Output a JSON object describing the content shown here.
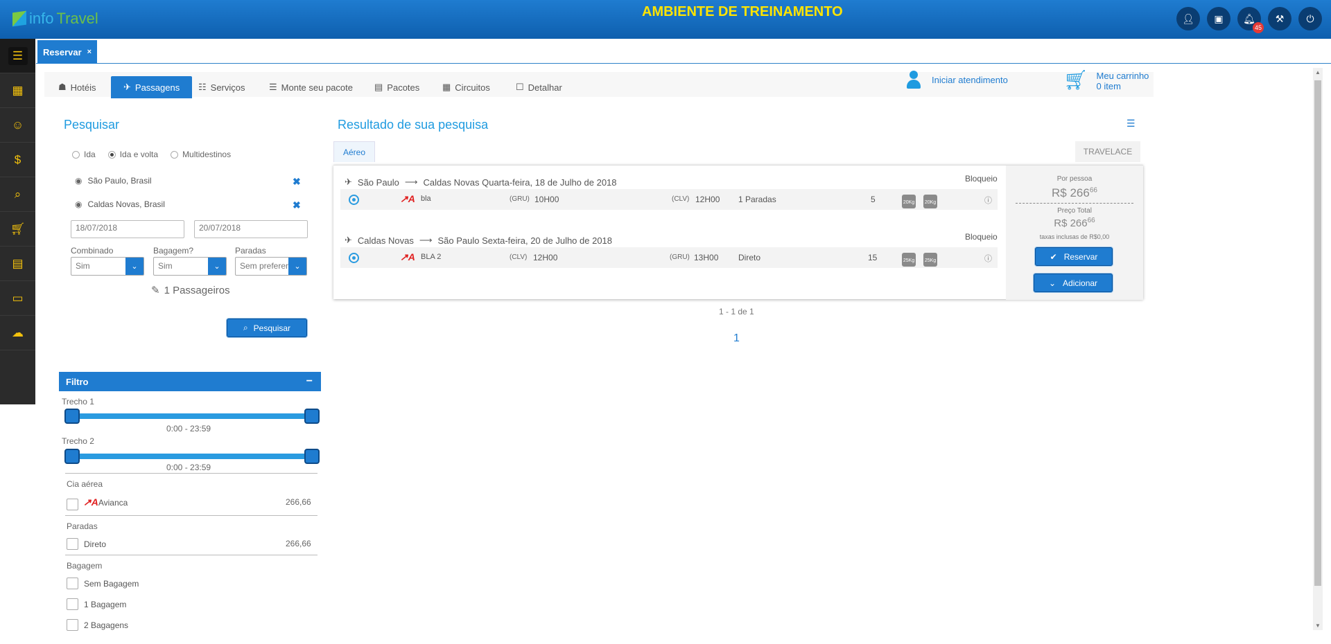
{
  "header": {
    "logo_info": "info",
    "logo_travel": "Travel",
    "env_title": "AMBIENTE DE TREINAMENTO",
    "notification_count": "45",
    "icons": [
      "user-icon",
      "money-icon",
      "bell-icon",
      "wrench-icon",
      "power-icon"
    ]
  },
  "leftnav": {
    "icons": [
      "list-icon",
      "building-icon",
      "users-icon",
      "dollar-icon",
      "search-icon",
      "cart-icon",
      "document-icon",
      "cash-icon",
      "cloud-icon"
    ]
  },
  "tabstrip": {
    "tab_label": "Reservar",
    "close": "×"
  },
  "main_tabs": {
    "hoteis": "Hotéis",
    "passagens": "Passagens",
    "servicos": "Serviços",
    "monte": "Monte seu pacote",
    "pacotes": "Pacotes",
    "circuitos": "Circuitos",
    "detalhar": "Detalhar",
    "iniciar": "Iniciar atendimento",
    "carrinho_title": "Meu carrinho",
    "carrinho_count": "0 item"
  },
  "search": {
    "title": "Pesquisar",
    "trip_types": [
      "Ida",
      "Ida e volta",
      "Multidestinos"
    ],
    "selected_trip_type": "Ida e volta",
    "origin": "São Paulo, Brasil",
    "destination": "Caldas Novas, Brasil",
    "date_out": "18/07/2018",
    "date_back": "20/07/2018",
    "combinado_label": "Combinado",
    "combinado_value": "Sim",
    "bagagem_label": "Bagagem?",
    "bagagem_value": "Sim",
    "paradas_label": "Paradas",
    "paradas_value": "Sem preferencia",
    "passengers": "1 Passageiros",
    "button": "Pesquisar"
  },
  "filter": {
    "title": "Filtro",
    "trecho1_label": "Trecho 1",
    "trecho1_range": "0:00 - 23:59",
    "trecho2_label": "Trecho 2",
    "trecho2_range": "0:00 - 23:59",
    "cia_label": "Cia aérea",
    "cia_item": "Avianca",
    "cia_price": "266,66",
    "paradas_label": "Paradas",
    "paradas_item": "Direto",
    "paradas_price": "266,66",
    "bagagem_label": "Bagagem",
    "bagagem_items": [
      "Sem Bagagem",
      "1 Bagagem",
      "2 Bagagens"
    ]
  },
  "results": {
    "title": "Resultado de sua pesquisa",
    "tab_aereo": "Aéreo",
    "tab_travelace": "TRAVELACE",
    "legs": [
      {
        "from": "São Paulo",
        "to": "Caldas Novas",
        "date": "Quarta-feira, 18 de Julho de 2018",
        "status": "Bloqueio",
        "flight": "bla",
        "dep_airport": "(GRU)",
        "dep_time": "10H00",
        "arr_airport": "(CLV)",
        "arr_time": "12H00",
        "stops": "1 Paradas",
        "seats": "5",
        "bag_weight": "20Kg"
      },
      {
        "from": "Caldas Novas",
        "to": "São Paulo",
        "date": "Sexta-feira, 20 de Julho de 2018",
        "status": "Bloqueio",
        "flight": "BLA 2",
        "dep_airport": "(CLV)",
        "dep_time": "12H00",
        "arr_airport": "(GRU)",
        "arr_time": "13H00",
        "stops": "Direto",
        "seats": "15",
        "bag_weight": "25Kg"
      }
    ],
    "price": {
      "per_person_label": "Por pessoa",
      "per_person_main": "R$ 266",
      "per_person_cents": "66",
      "total_label": "Preço Total",
      "total_main": "R$ 266",
      "total_cents": "66",
      "taxes": "taxas inclusas de R$0,00",
      "reserve_button": "Reservar",
      "add_button": "Adicionar"
    },
    "pager_info": "1 - 1 de 1",
    "page": "1"
  }
}
